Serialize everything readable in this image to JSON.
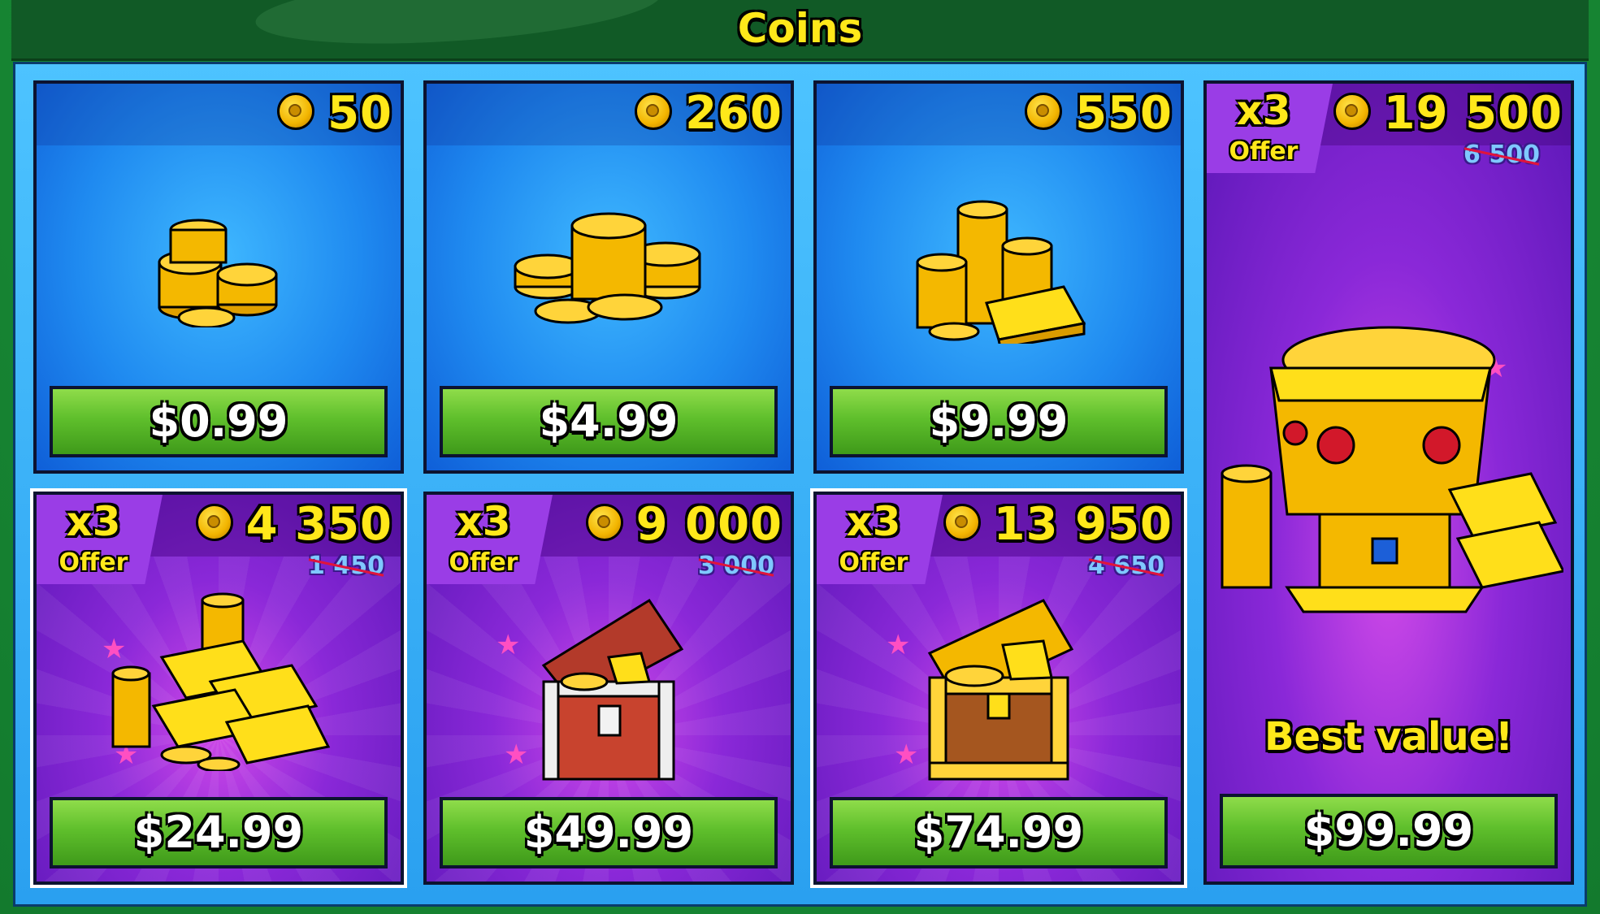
{
  "screen": {
    "title": "Coins"
  },
  "packs": [
    {
      "amount": "50",
      "price": "$0.99",
      "art_icon": "small-coin-stack-icon"
    },
    {
      "amount": "260",
      "price": "$4.99",
      "art_icon": "coin-pile-icon"
    },
    {
      "amount": "550",
      "price": "$9.99",
      "art_icon": "coins-and-gold-bar-icon"
    },
    {
      "amount": "19 500",
      "old_amount": "6 500",
      "multiplier": "x3",
      "offer_label": "Offer",
      "price": "$99.99",
      "tagline": "Best value!",
      "art_icon": "golden-treasure-chest-tower-icon"
    },
    {
      "amount": "4 350",
      "old_amount": "1 450",
      "multiplier": "x3",
      "offer_label": "Offer",
      "price": "$24.99",
      "art_icon": "gold-bars-pile-icon"
    },
    {
      "amount": "9 000",
      "old_amount": "3 000",
      "multiplier": "x3",
      "offer_label": "Offer",
      "price": "$49.99",
      "art_icon": "wooden-treasure-chest-icon"
    },
    {
      "amount": "13 950",
      "old_amount": "4 650",
      "multiplier": "x3",
      "offer_label": "Offer",
      "price": "$74.99",
      "art_icon": "gold-treasure-chest-icon"
    }
  ],
  "colors": {
    "accent_yellow": "#ffe81a",
    "button_green": "#5fbf2c",
    "card_blue": "#1f8af0",
    "card_purple": "#8a28d8",
    "strike_red": "#e0143c"
  }
}
